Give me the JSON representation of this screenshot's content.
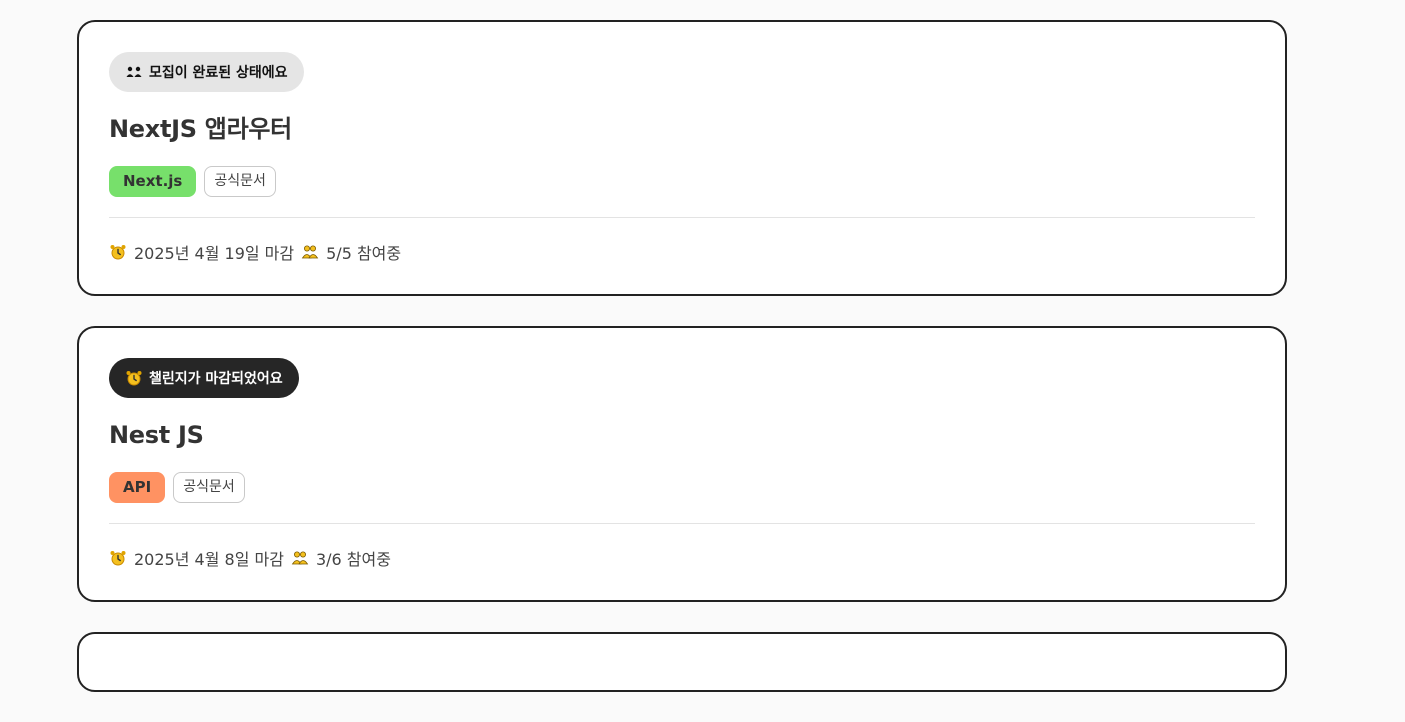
{
  "challenges": [
    {
      "status_label": "모집이 완료된 상태에요",
      "status_icon": "people-icon",
      "status_style": "done",
      "title": "NextJS 앱라우터",
      "category": "Next.js",
      "category_color": "#77e06b",
      "doc_type": "공식문서",
      "deadline": "2025년 4월 19일 마감",
      "participants": "5/5 참여중"
    },
    {
      "status_label": "챌린지가 마감되었어요",
      "status_icon": "alarm-clock-icon",
      "status_style": "closed",
      "title": "Nest JS",
      "category": "API",
      "category_color": "#ff9262",
      "doc_type": "공식문서",
      "deadline": "2025년 4월 8일 마감",
      "participants": "3/6 참여중"
    }
  ],
  "colors": {
    "icon_yellow": "#f4c01e",
    "card_border": "#222222"
  }
}
